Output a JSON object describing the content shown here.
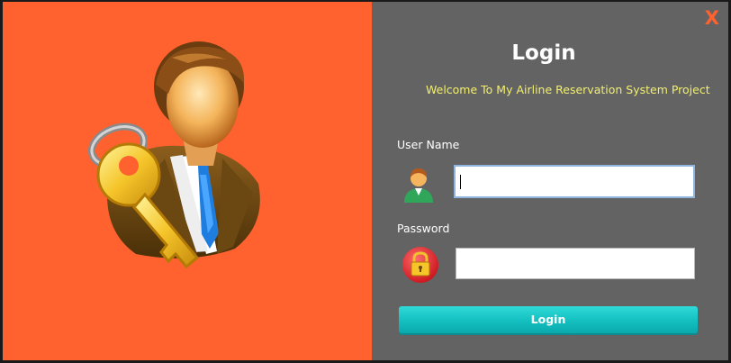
{
  "window": {
    "close_label": "X"
  },
  "hero": {
    "icon": "user-with-key-icon"
  },
  "login": {
    "title": "Login",
    "welcome": "Welcome To My Airline Reservation System Project",
    "username_label": "User Name",
    "username_value": "",
    "username_icon": "user-icon",
    "password_label": "Password",
    "password_value": "",
    "password_icon": "lock-icon",
    "button_label": "Login"
  },
  "colors": {
    "accent_orange": "#ff612f",
    "panel_gray": "#636363",
    "welcome_yellow": "#f2ef6e",
    "button_teal": "#14bfc0"
  }
}
